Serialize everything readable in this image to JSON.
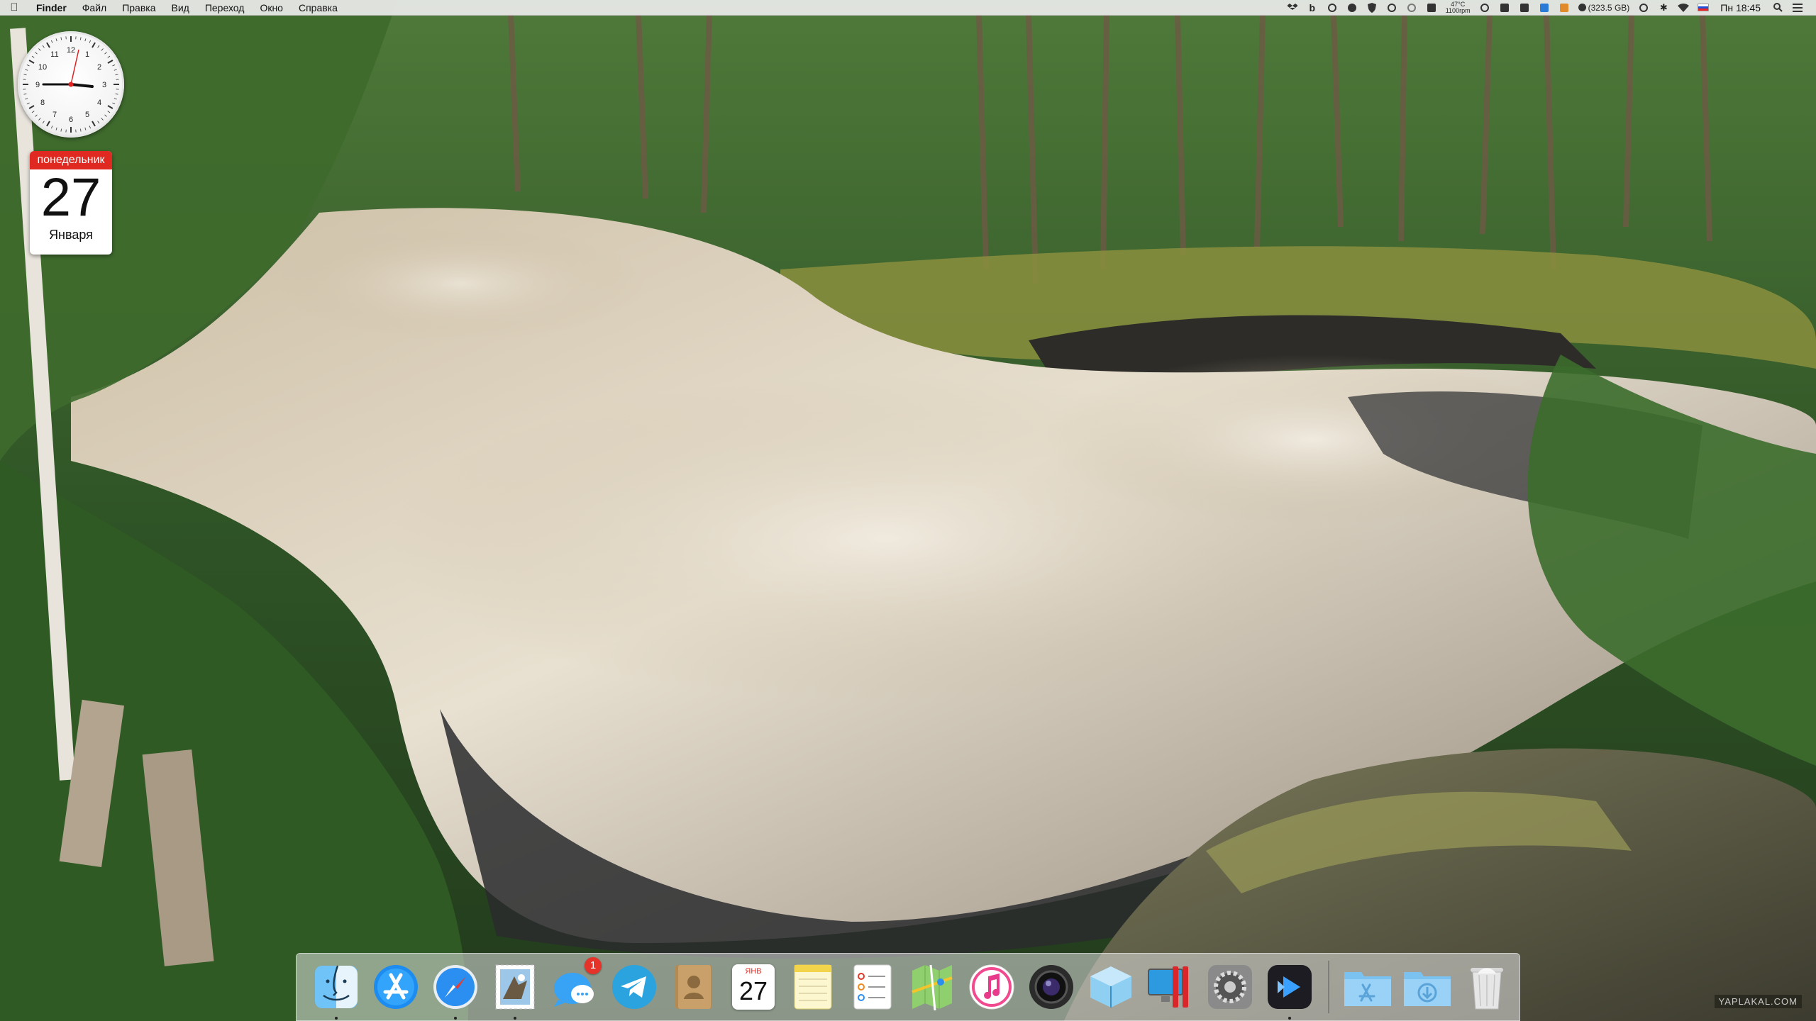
{
  "menubar": {
    "apple_icon": "apple-logo-icon",
    "app_name": "Finder",
    "items": [
      "Файл",
      "Правка",
      "Вид",
      "Переход",
      "Окно",
      "Справка"
    ],
    "status": {
      "temperature": "47°C",
      "fan_speed": "1100rpm",
      "disk_free": "(323.5 GB)",
      "clock": "Пн 18:45"
    }
  },
  "widgets": {
    "calendar": {
      "weekday": "понедельник",
      "day": "27",
      "month": "Января"
    }
  },
  "dock": {
    "apps": [
      {
        "name": "Finder",
        "icon": "finder-icon",
        "running": true
      },
      {
        "name": "App Store",
        "icon": "app-store-icon",
        "running": false
      },
      {
        "name": "Safari",
        "icon": "safari-icon",
        "running": true
      },
      {
        "name": "Mail",
        "icon": "mail-stamp-icon",
        "running": true
      },
      {
        "name": "Messages",
        "icon": "messages-icon",
        "running": false,
        "badge": "1"
      },
      {
        "name": "Telegram",
        "icon": "telegram-icon",
        "running": false
      },
      {
        "name": "Contacts",
        "icon": "contacts-icon",
        "running": false
      },
      {
        "name": "Calendar",
        "icon": "calendar-icon",
        "running": false,
        "month_abbr": "ЯНВ",
        "day": "27"
      },
      {
        "name": "Notes",
        "icon": "notes-icon",
        "running": false
      },
      {
        "name": "Reminders",
        "icon": "reminders-icon",
        "running": false
      },
      {
        "name": "Maps",
        "icon": "maps-icon",
        "running": false
      },
      {
        "name": "iTunes",
        "icon": "itunes-icon",
        "running": false
      },
      {
        "name": "Photo Booth",
        "icon": "camera-lens-icon",
        "running": false
      },
      {
        "name": "VirtualBox",
        "icon": "virtualbox-icon",
        "running": false
      },
      {
        "name": "Parallels",
        "icon": "parallels-icon",
        "running": false
      },
      {
        "name": "System Preferences",
        "icon": "gear-icon",
        "running": false
      },
      {
        "name": "Infuse",
        "icon": "play-icon",
        "running": true
      }
    ],
    "stacks": [
      {
        "name": "Applications",
        "icon": "applications-folder-icon"
      },
      {
        "name": "Downloads",
        "icon": "downloads-folder-icon"
      },
      {
        "name": "Trash",
        "icon": "trash-icon"
      }
    ]
  },
  "watermark": "YAPLAKAL.COM",
  "colors": {
    "accent_red": "#e02a21",
    "badge_red": "#e5332a",
    "menubar_bg": "#ececec"
  }
}
